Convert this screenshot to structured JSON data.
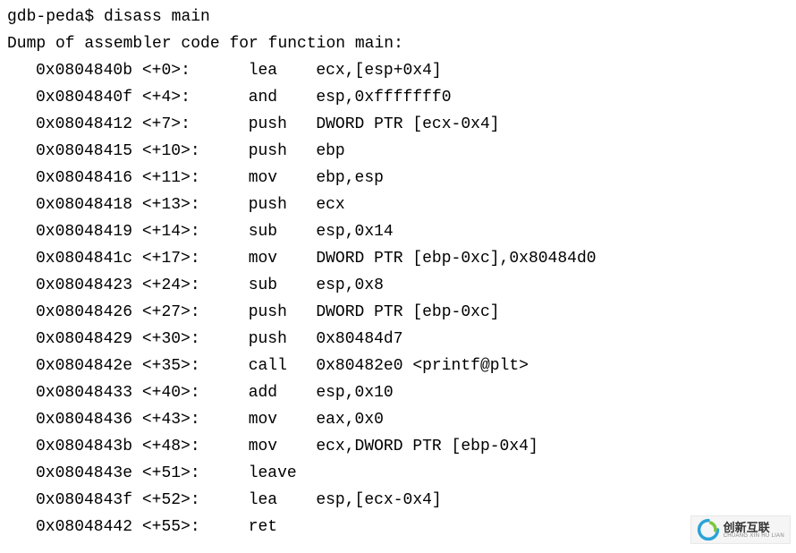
{
  "prompt": "gdb-peda$ ",
  "command": "disass main",
  "dump_header": "Dump of assembler code for function main:",
  "instructions": [
    {
      "addr": "0x0804840b",
      "offset": "<+0>",
      "mnemonic": "lea",
      "operands": "ecx,[esp+0x4]"
    },
    {
      "addr": "0x0804840f",
      "offset": "<+4>",
      "mnemonic": "and",
      "operands": "esp,0xfffffff0"
    },
    {
      "addr": "0x08048412",
      "offset": "<+7>",
      "mnemonic": "push",
      "operands": "DWORD PTR [ecx-0x4]"
    },
    {
      "addr": "0x08048415",
      "offset": "<+10>",
      "mnemonic": "push",
      "operands": "ebp"
    },
    {
      "addr": "0x08048416",
      "offset": "<+11>",
      "mnemonic": "mov",
      "operands": "ebp,esp"
    },
    {
      "addr": "0x08048418",
      "offset": "<+13>",
      "mnemonic": "push",
      "operands": "ecx"
    },
    {
      "addr": "0x08048419",
      "offset": "<+14>",
      "mnemonic": "sub",
      "operands": "esp,0x14"
    },
    {
      "addr": "0x0804841c",
      "offset": "<+17>",
      "mnemonic": "mov",
      "operands": "DWORD PTR [ebp-0xc],0x80484d0"
    },
    {
      "addr": "0x08048423",
      "offset": "<+24>",
      "mnemonic": "sub",
      "operands": "esp,0x8"
    },
    {
      "addr": "0x08048426",
      "offset": "<+27>",
      "mnemonic": "push",
      "operands": "DWORD PTR [ebp-0xc]"
    },
    {
      "addr": "0x08048429",
      "offset": "<+30>",
      "mnemonic": "push",
      "operands": "0x80484d7"
    },
    {
      "addr": "0x0804842e",
      "offset": "<+35>",
      "mnemonic": "call",
      "operands": "0x80482e0 <printf@plt>"
    },
    {
      "addr": "0x08048433",
      "offset": "<+40>",
      "mnemonic": "add",
      "operands": "esp,0x10"
    },
    {
      "addr": "0x08048436",
      "offset": "<+43>",
      "mnemonic": "mov",
      "operands": "eax,0x0"
    },
    {
      "addr": "0x0804843b",
      "offset": "<+48>",
      "mnemonic": "mov",
      "operands": "ecx,DWORD PTR [ebp-0x4]"
    },
    {
      "addr": "0x0804843e",
      "offset": "<+51>",
      "mnemonic": "leave",
      "operands": ""
    },
    {
      "addr": "0x0804843f",
      "offset": "<+52>",
      "mnemonic": "lea",
      "operands": "esp,[ecx-0x4]"
    },
    {
      "addr": "0x08048442",
      "offset": "<+55>",
      "mnemonic": "ret",
      "operands": ""
    }
  ],
  "watermark": {
    "cn": "创新互联",
    "en": "CHUANG XIN HU LIAN"
  }
}
